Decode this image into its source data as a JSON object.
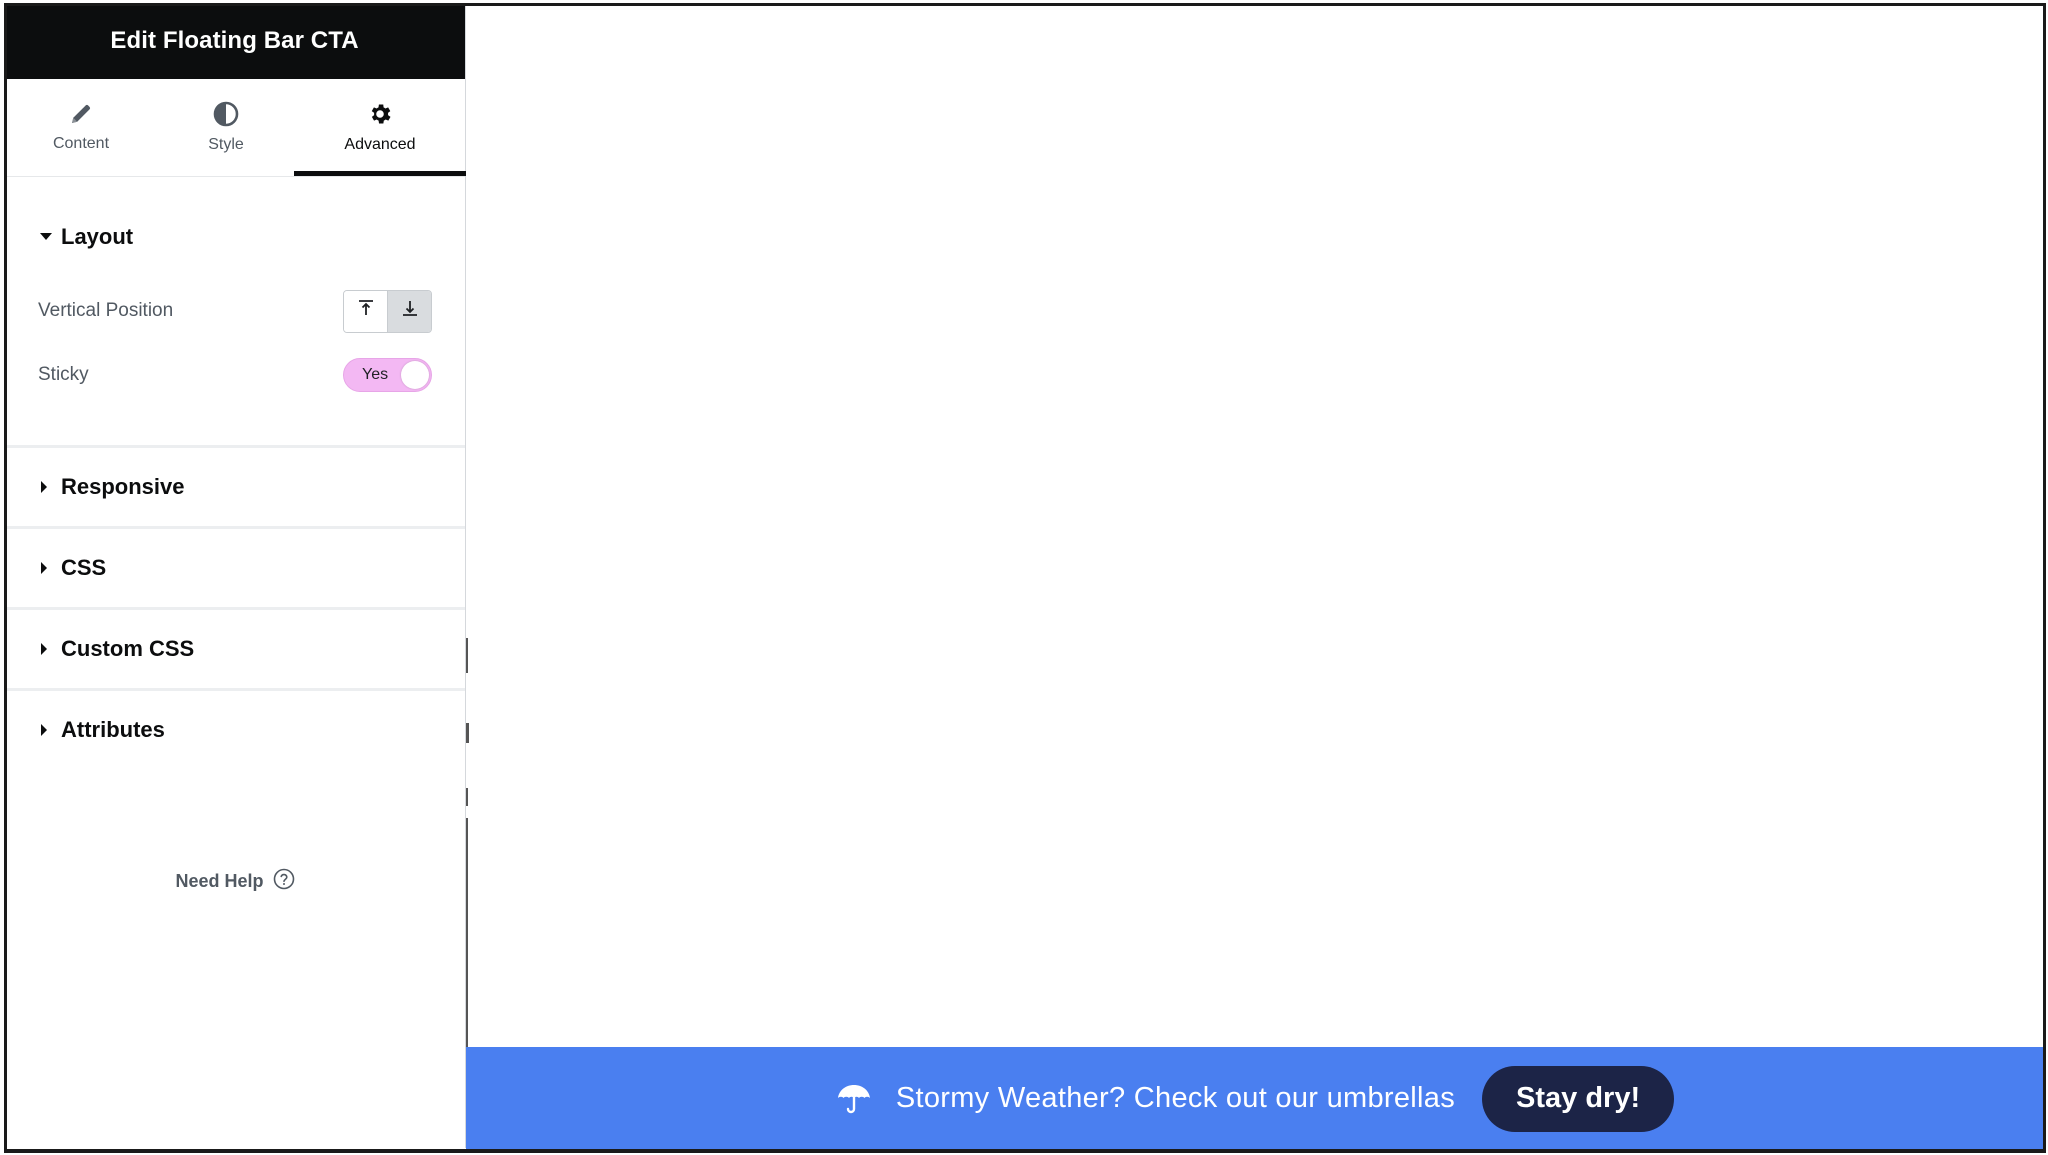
{
  "panel": {
    "title": "Edit Floating Bar CTA",
    "tabs": [
      {
        "label": "Content",
        "icon": "pencil-icon"
      },
      {
        "label": "Style",
        "icon": "half-circle-icon"
      },
      {
        "label": "Advanced",
        "icon": "gear-icon",
        "active": true
      }
    ],
    "sections": {
      "layout": {
        "title": "Layout",
        "expanded": true,
        "vertical_position_label": "Vertical Position",
        "vertical_position_value": "bottom",
        "sticky_label": "Sticky",
        "sticky_value": "Yes"
      },
      "responsive": {
        "title": "Responsive"
      },
      "css": {
        "title": "CSS"
      },
      "custom_css": {
        "title": "Custom CSS"
      },
      "attributes": {
        "title": "Attributes"
      }
    },
    "help_label": "Need Help"
  },
  "floating_bar": {
    "icon": "umbrella-icon",
    "text": "Stormy Weather? Check out our umbrellas",
    "button_label": "Stay dry!",
    "background_color": "#4a7ff0",
    "button_color": "#1c2447"
  },
  "colors": {
    "header_bg": "#0c0d0e",
    "toggle_on": "#f3b8f3"
  }
}
